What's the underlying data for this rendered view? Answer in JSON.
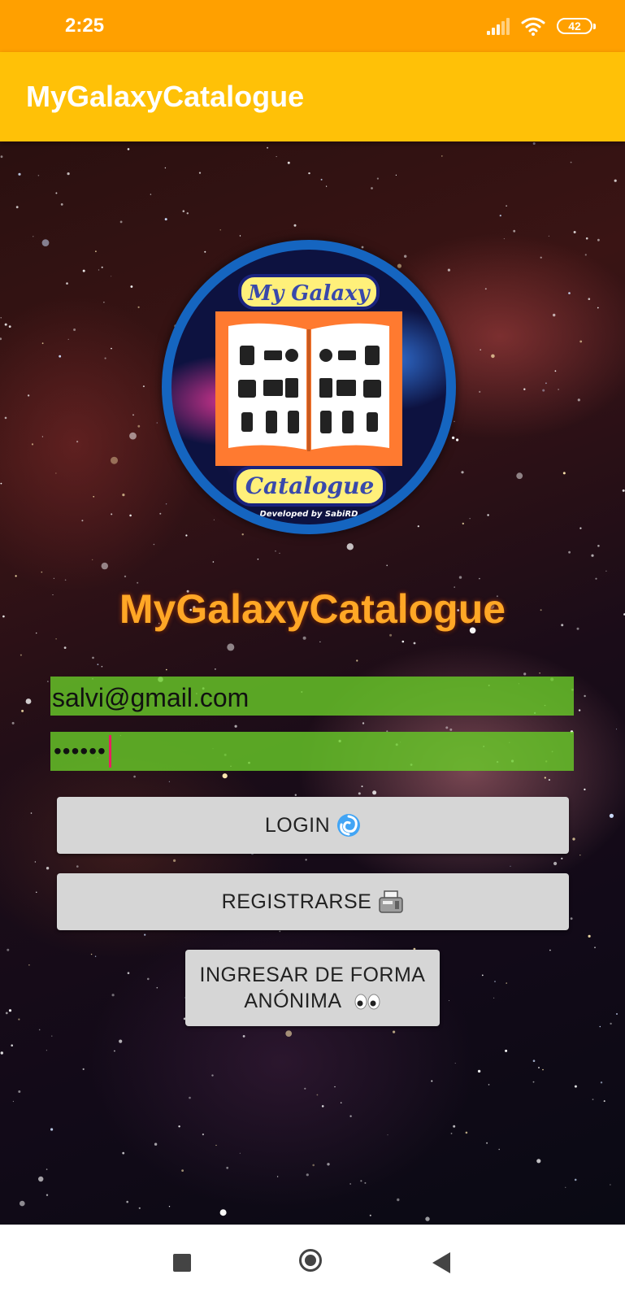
{
  "status_bar": {
    "time": "2:25",
    "battery": "42",
    "icons": [
      "signal-icon",
      "wifi-icon",
      "battery-icon"
    ]
  },
  "app_bar": {
    "title": "MyGalaxyCatalogue"
  },
  "logo": {
    "top_text": "My Galaxy",
    "bottom_text": "Catalogue",
    "credit": "Developed by SabiRD"
  },
  "brand": {
    "title": "MyGalaxyCatalogue"
  },
  "form": {
    "email_value": "salvi@gmail.com",
    "password_dots": "••••••"
  },
  "buttons": {
    "login_label": "LOGIN",
    "register_label": "REGISTRARSE",
    "anon_line1": "INGRESAR DE FORMA",
    "anon_line2": "ANÓNIMA"
  },
  "colors": {
    "status_bar": "#ffa000",
    "app_bar": "#ffc107",
    "brand_title": "#ffa726",
    "input_bg": "#68c828",
    "button_bg": "#d6d6d6",
    "logo_ring": "#1565c0",
    "book_orange": "#ff7a30"
  },
  "nav_bar": {
    "icons": [
      "recent-apps-icon",
      "home-icon",
      "back-icon"
    ]
  }
}
